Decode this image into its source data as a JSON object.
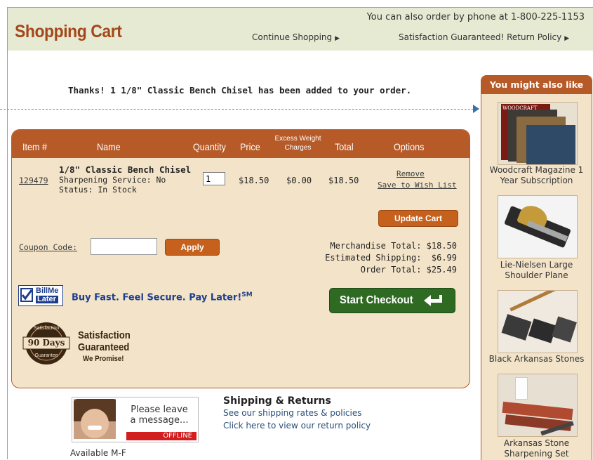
{
  "header": {
    "title": "Shopping Cart",
    "phone": "You can also order by phone at 1-800-225-1153",
    "continue_label": "Continue Shopping",
    "guarantee_label": "Satisfaction Guaranteed! Return Policy"
  },
  "thanks_message": "Thanks! 1 1/8\" Classic Bench Chisel has been added to your order.",
  "cart": {
    "columns": {
      "item": "Item #",
      "name": "Name",
      "quantity": "Quantity",
      "price": "Price",
      "excess_line1": "Excess Weight",
      "excess_line2": "Charges",
      "total": "Total",
      "options": "Options"
    },
    "item": {
      "number": "129479",
      "name": "1/8\" Classic Bench Chisel",
      "sharpening": "Sharpening Service: No",
      "status": "Status: In Stock",
      "quantity": "1",
      "price": "$18.50",
      "excess": "$0.00",
      "total": "$18.50",
      "remove": "Remove",
      "wishlist": "Save to Wish List"
    },
    "update_label": "Update Cart",
    "coupon_label": "Coupon Code:",
    "coupon_value": "",
    "apply_label": "Apply",
    "totals": {
      "merchandise": "Merchandise Total: $18.50",
      "shipping": "Estimated Shipping:  $6.99",
      "order": "Order Total: $25.49"
    },
    "billme": {
      "logo_line1": "BillMe",
      "logo_line2": "Later",
      "tagline": "Buy Fast. Feel Secure. Pay Later!",
      "mark": "SM"
    },
    "checkout_label": "Start Checkout",
    "guarantee": {
      "seal_top": "Satisfaction",
      "seal_mid": "90 Days",
      "seal_bottom": "Guarantee",
      "line1": "Satisfaction",
      "line2": "Guaranteed",
      "line3": "We Promise!"
    }
  },
  "sidebar": {
    "title": "You might also like",
    "products": [
      {
        "name": "Woodcraft Magazine 1 Year Subscription"
      },
      {
        "name": "Lie-Nielsen Large Shoulder Plane"
      },
      {
        "name": "Black Arkansas Stones"
      },
      {
        "name": "Arkansas Stone Sharpening Set"
      }
    ]
  },
  "chat": {
    "line1": "Please leave",
    "line2": "a message...",
    "status": "OFFLINE",
    "availability": "Available M-F"
  },
  "shipping": {
    "title": "Shipping & Returns",
    "rates": "See our shipping rates & policies",
    "returns": "Click here to view our return policy"
  }
}
